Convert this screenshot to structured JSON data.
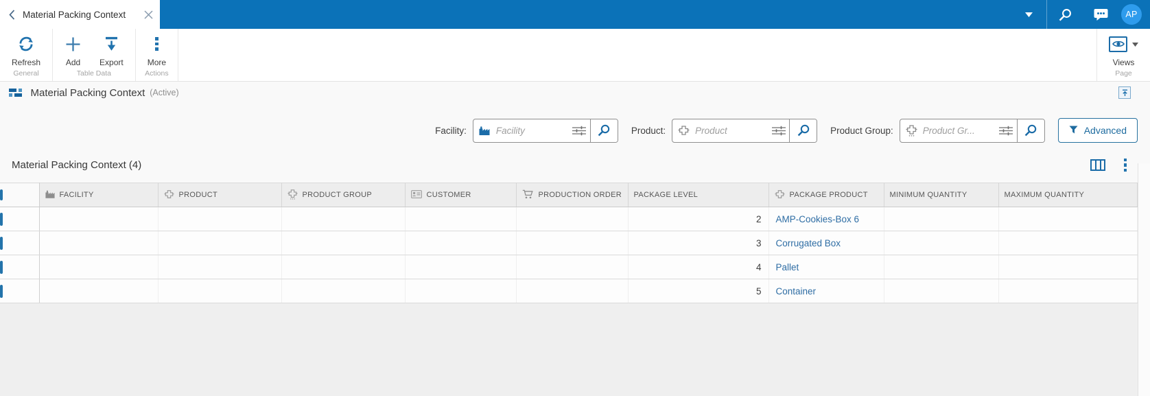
{
  "topbar": {
    "tab": {
      "label": "Material Packing Context",
      "back_icon": "chevron-left-icon",
      "close_icon": "close-icon"
    },
    "icons": [
      "chevron-down-icon",
      "search-icon",
      "chat-icon"
    ],
    "avatar_initials": "AP"
  },
  "ribbon": {
    "groups": [
      {
        "label": "General",
        "buttons": [
          {
            "label": "Refresh",
            "icon": "refresh-icon"
          }
        ]
      },
      {
        "label": "Table Data",
        "buttons": [
          {
            "label": "Add",
            "icon": "add-icon"
          },
          {
            "label": "Export",
            "icon": "export-icon"
          }
        ]
      },
      {
        "label": "Actions",
        "buttons": [
          {
            "label": "More",
            "icon": "more-kebab-icon"
          }
        ]
      },
      {
        "label": "Page",
        "buttons": [
          {
            "label": "Views",
            "icon": "eye-icon"
          }
        ]
      }
    ]
  },
  "section": {
    "icon": "layout-blocks-icon",
    "title": "Material Packing Context",
    "status": "(Active)",
    "collapse_icon": "collapse-panel-icon"
  },
  "filters": [
    {
      "label": "Facility:",
      "placeholder": "Facility",
      "icon": "facility-icon",
      "extra_icons": [
        "sliders-icon",
        "search-icon"
      ]
    },
    {
      "label": "Product:",
      "placeholder": "Product",
      "icon": "product-icon",
      "extra_icons": [
        "sliders-icon",
        "search-icon"
      ]
    },
    {
      "label": "Product Group:",
      "placeholder": "Product Gr...",
      "icon": "product-group-icon",
      "extra_icons": [
        "sliders-icon",
        "search-icon"
      ]
    }
  ],
  "advanced_button": {
    "label": "Advanced",
    "icon": "filter-funnel-icon"
  },
  "table": {
    "title": "Material Packing Context (4)",
    "toolbar_icons": [
      "columns-icon",
      "kebab-menu-icon"
    ],
    "columns": [
      {
        "label": "FACILITY",
        "icon": "facility-icon"
      },
      {
        "label": "PRODUCT",
        "icon": "product-icon"
      },
      {
        "label": "PRODUCT GROUP",
        "icon": "product-group-icon"
      },
      {
        "label": "CUSTOMER",
        "icon": "customer-card-icon"
      },
      {
        "label": "PRODUCTION ORDER",
        "icon": "cart-icon"
      },
      {
        "label": "PACKAGE LEVEL",
        "icon": ""
      },
      {
        "label": "PACKAGE PRODUCT",
        "icon": "product-icon"
      },
      {
        "label": "MINIMUM QUANTITY",
        "icon": ""
      },
      {
        "label": "MAXIMUM QUANTITY",
        "icon": ""
      }
    ],
    "rows": [
      {
        "facility": "",
        "product": "",
        "product_group": "",
        "customer": "",
        "production_order": "",
        "package_level": "2",
        "package_product": "AMP-Cookies-Box 6",
        "minimum_quantity": "",
        "maximum_quantity": ""
      },
      {
        "facility": "",
        "product": "",
        "product_group": "",
        "customer": "",
        "production_order": "",
        "package_level": "3",
        "package_product": "Corrugated Box",
        "minimum_quantity": "",
        "maximum_quantity": ""
      },
      {
        "facility": "",
        "product": "",
        "product_group": "",
        "customer": "",
        "production_order": "",
        "package_level": "4",
        "package_product": "Pallet",
        "minimum_quantity": "",
        "maximum_quantity": ""
      },
      {
        "facility": "",
        "product": "",
        "product_group": "",
        "customer": "",
        "production_order": "",
        "package_level": "5",
        "package_product": "Container",
        "minimum_quantity": "",
        "maximum_quantity": ""
      }
    ]
  },
  "colors": {
    "topbar_blue": "#0b72b8",
    "avatar_blue": "#2e9ced",
    "accent_blue": "#1b6ca8",
    "link_blue": "#2e6da4",
    "header_gray": "#ededed"
  }
}
